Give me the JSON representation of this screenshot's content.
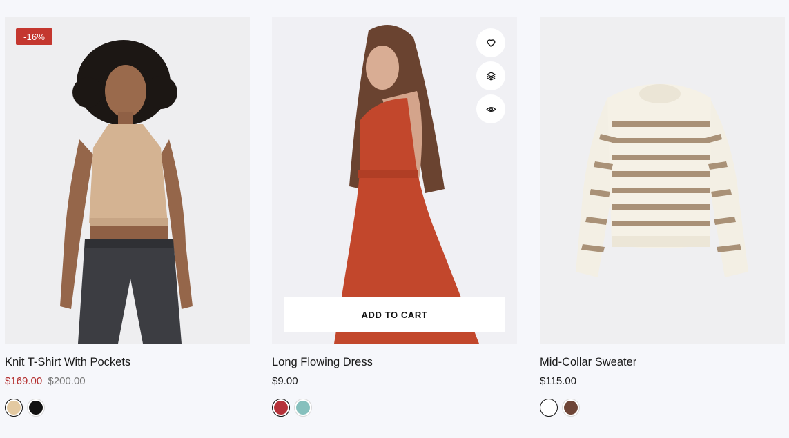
{
  "products": [
    {
      "title": "Knit T-Shirt With Pockets",
      "badge": "-16%",
      "price": "$169.00",
      "old_price": "$200.00",
      "swatches": [
        {
          "color": "#e3c9a1",
          "name": "beige",
          "active": true
        },
        {
          "color": "#111111",
          "name": "black",
          "active": false
        }
      ]
    },
    {
      "title": "Long Flowing Dress",
      "price": "$9.00",
      "add_to_cart": "ADD TO CART",
      "actions": [
        "heart-icon",
        "layers-icon",
        "eye-icon"
      ],
      "swatches": [
        {
          "color": "#b5323a",
          "name": "red",
          "active": true
        },
        {
          "color": "#86c0bd",
          "name": "teal",
          "active": false
        }
      ]
    },
    {
      "title": "Mid-Collar Sweater",
      "price": "$115.00",
      "swatches": [
        {
          "color": "#ffffff",
          "name": "white",
          "active": true
        },
        {
          "color": "#6d4436",
          "name": "brown",
          "active": false
        }
      ]
    }
  ]
}
